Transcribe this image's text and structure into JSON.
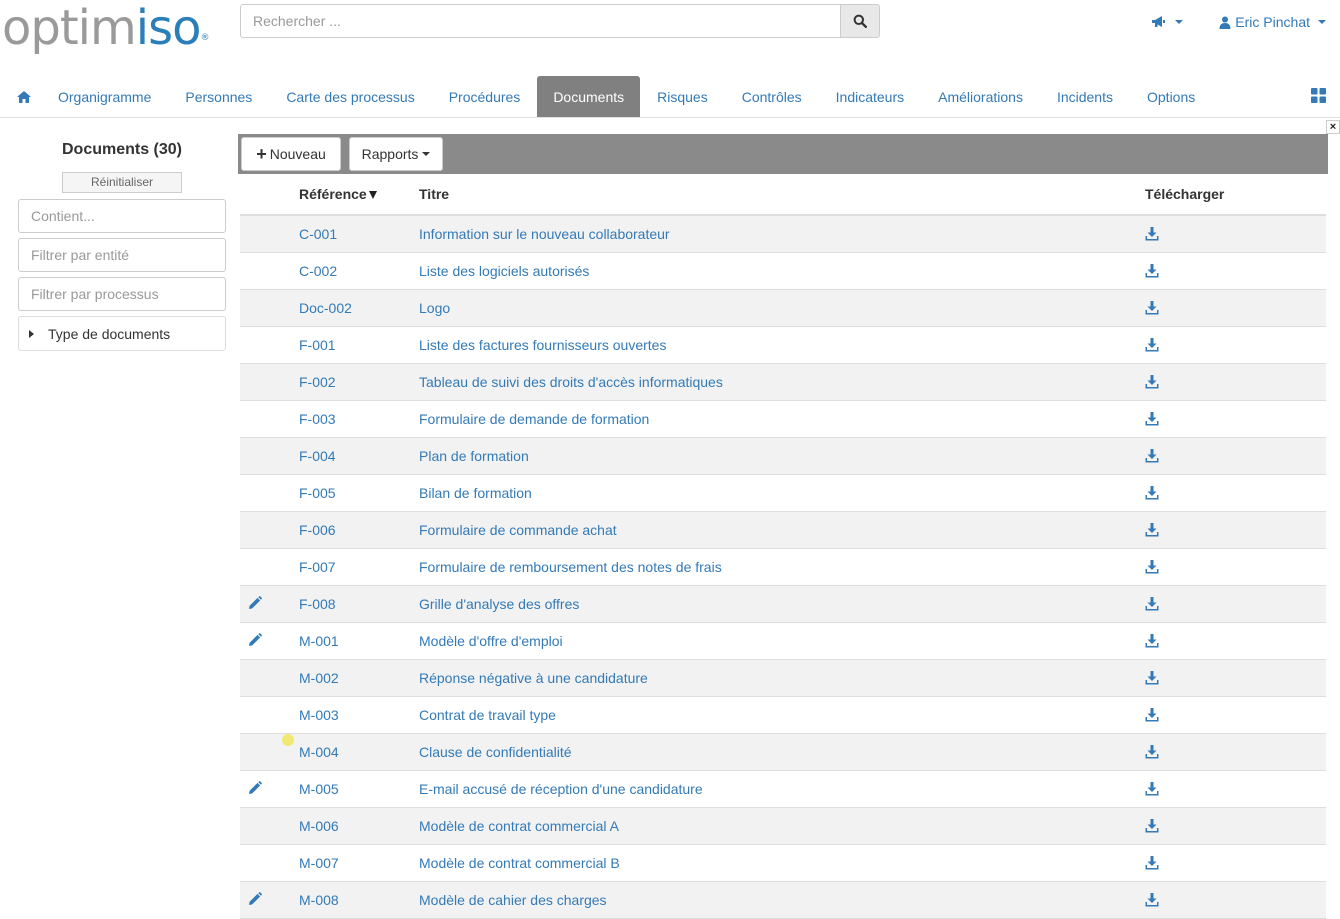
{
  "brand": {
    "part1": "optim",
    "part2": "is",
    "part3": "o",
    "reg": "®"
  },
  "search": {
    "placeholder": "Rechercher ..."
  },
  "topbar": {
    "user_name": "Eric Pinchat"
  },
  "nav": {
    "items": [
      "Organigramme",
      "Personnes",
      "Carte des processus",
      "Procédures",
      "Documents",
      "Risques",
      "Contrôles",
      "Indicateurs",
      "Améliorations",
      "Incidents",
      "Options"
    ],
    "active": "Documents"
  },
  "sidebar": {
    "title": "Documents (30)",
    "reset_label": "Réinitialiser",
    "filter_contains_placeholder": "Contient...",
    "filter_entity_placeholder": "Filtrer par entité",
    "filter_process_placeholder": "Filtrer par processus",
    "doc_type_label": "Type de documents"
  },
  "toolbar": {
    "new_label": "Nouveau",
    "reports_label": "Rapports"
  },
  "table": {
    "headers": {
      "reference": "Référence",
      "title": "Titre",
      "download": "Télécharger"
    },
    "rows": [
      {
        "ref": "C-001",
        "title": "Information sur le nouveau collaborateur",
        "editable": false
      },
      {
        "ref": "C-002",
        "title": "Liste des logiciels autorisés",
        "editable": false
      },
      {
        "ref": "Doc-002",
        "title": "Logo",
        "editable": false
      },
      {
        "ref": "F-001",
        "title": "Liste des factures fournisseurs ouvertes",
        "editable": false
      },
      {
        "ref": "F-002",
        "title": "Tableau de suivi des droits d'accès informatiques",
        "editable": false
      },
      {
        "ref": "F-003",
        "title": "Formulaire de demande de formation",
        "editable": false
      },
      {
        "ref": "F-004",
        "title": "Plan de formation",
        "editable": false
      },
      {
        "ref": "F-005",
        "title": "Bilan de formation",
        "editable": false
      },
      {
        "ref": "F-006",
        "title": "Formulaire de commande achat",
        "editable": false
      },
      {
        "ref": "F-007",
        "title": "Formulaire de remboursement des notes de frais",
        "editable": false
      },
      {
        "ref": "F-008",
        "title": "Grille d'analyse des offres",
        "editable": true
      },
      {
        "ref": "M-001",
        "title": "Modèle d'offre d'emploi",
        "editable": true
      },
      {
        "ref": "M-002",
        "title": "Réponse négative à une candidature",
        "editable": false
      },
      {
        "ref": "M-003",
        "title": "Contrat de travail type",
        "editable": false
      },
      {
        "ref": "M-004",
        "title": "Clause de confidentialité",
        "editable": false
      },
      {
        "ref": "M-005",
        "title": "E-mail accusé de réception d'une candidature",
        "editable": true
      },
      {
        "ref": "M-006",
        "title": "Modèle de contrat commercial A",
        "editable": false
      },
      {
        "ref": "M-007",
        "title": "Modèle de contrat commercial B",
        "editable": false
      },
      {
        "ref": "M-008",
        "title": "Modèle de cahier des charges",
        "editable": true
      }
    ]
  },
  "colors": {
    "link": "#337ab7",
    "nav_active_bg": "#808080",
    "toolbar_bg": "#8a8a8a",
    "logo_gray": "#9a9a9a",
    "logo_blue": "#2a7fb8"
  },
  "icons": [
    "home-icon",
    "search-icon",
    "megaphone-icon",
    "user-icon",
    "grid-icon",
    "close-icon",
    "plus-icon",
    "edit-pencil-icon",
    "download-icon"
  ]
}
